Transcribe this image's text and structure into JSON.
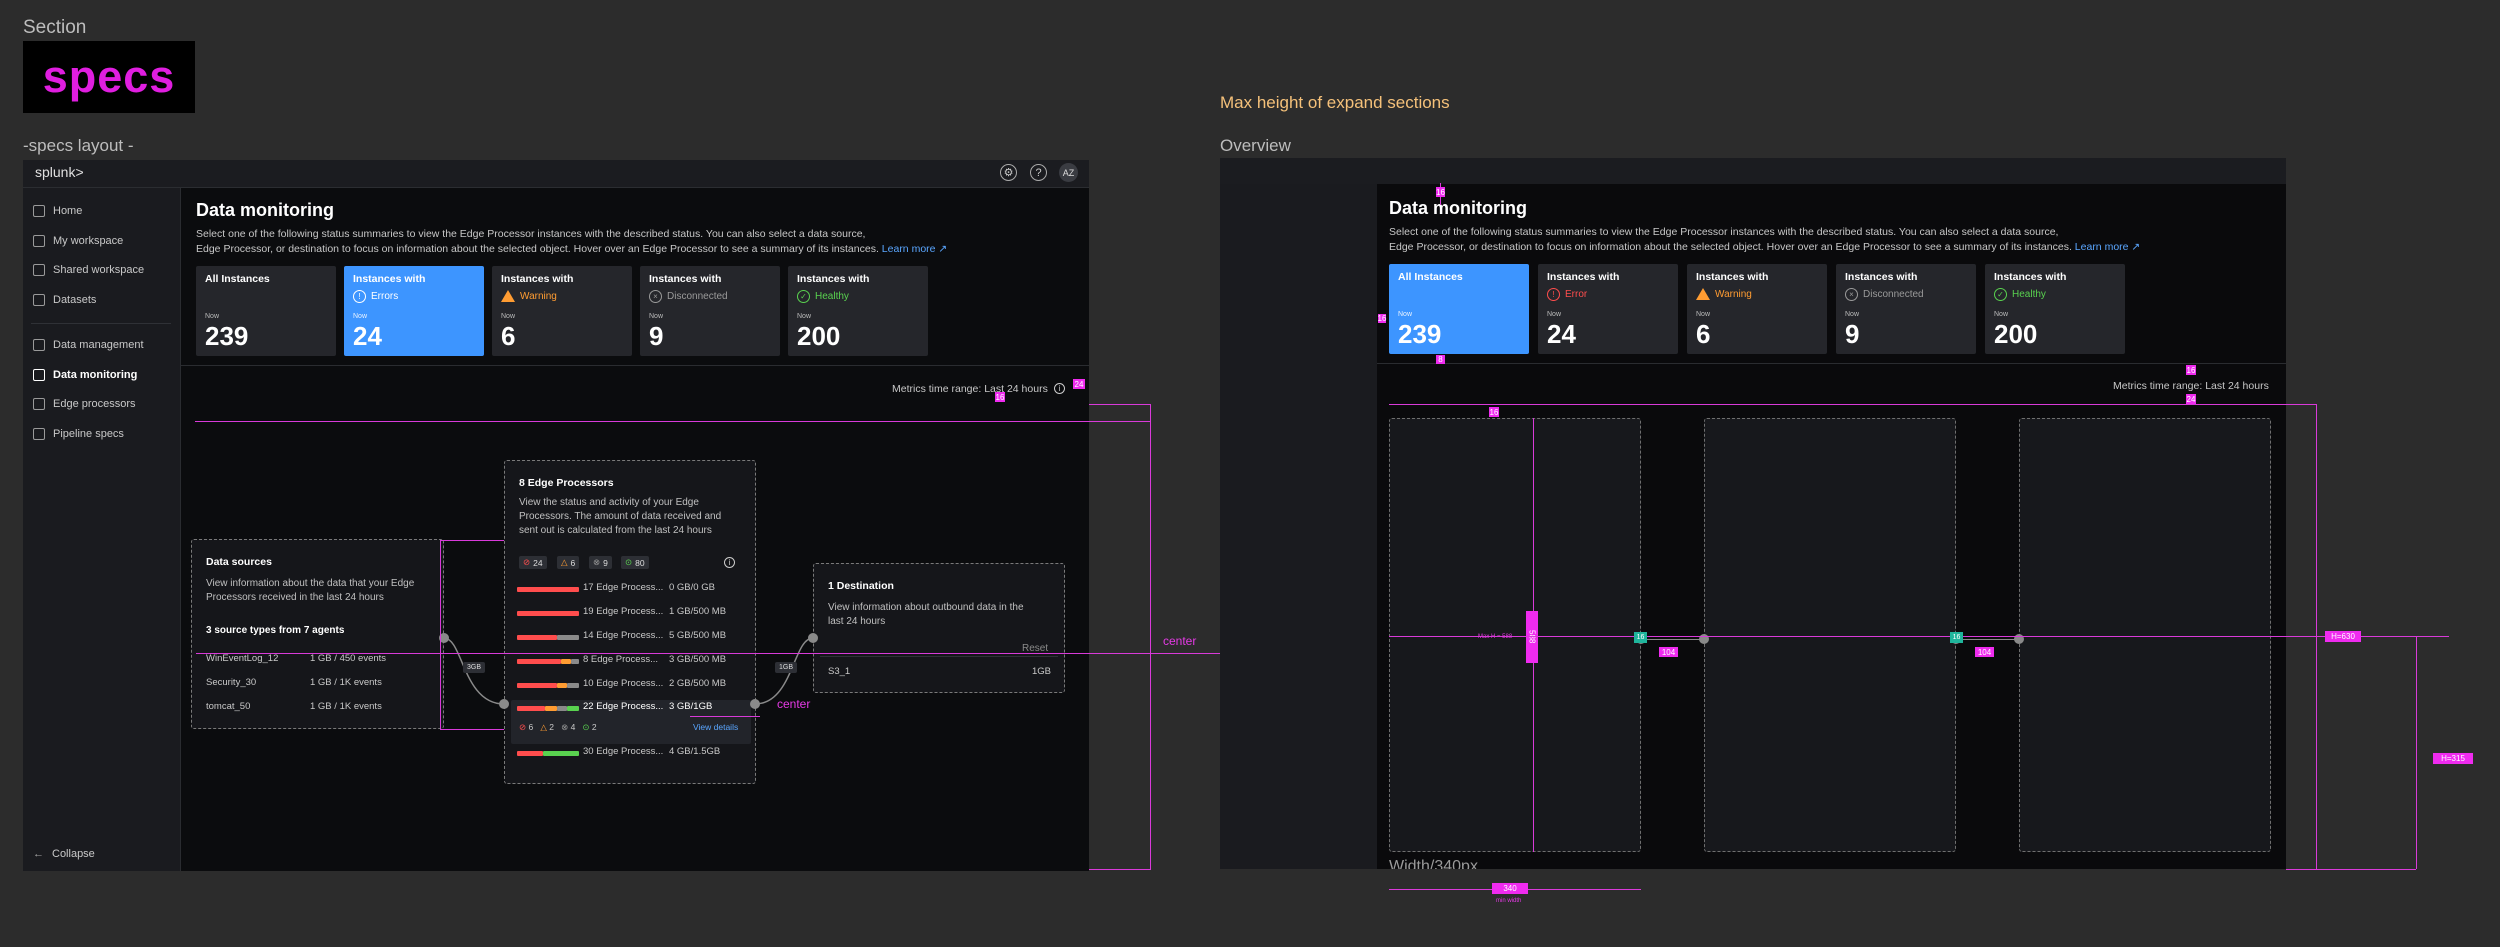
{
  "section_label": "Section",
  "specs_logo": "specs",
  "left_frame": {
    "label": "-specs layout -",
    "app": {
      "logo": "splunk>",
      "icons": [
        "gear-icon",
        "help-icon"
      ],
      "avatar": "AZ",
      "sidebar": {
        "items": [
          {
            "label": "Home",
            "icon": "home-icon"
          },
          {
            "label": "My workspace",
            "icon": "workspace-icon"
          },
          {
            "label": "Shared workspace",
            "icon": "shared-icon"
          },
          {
            "label": "Datasets",
            "icon": "dataset-icon"
          },
          {
            "label": "Data management",
            "icon": "data-icon"
          },
          {
            "label": "Data monitoring",
            "icon": "monitor-icon"
          },
          {
            "label": "Edge processors",
            "icon": "edge-icon"
          },
          {
            "label": "Pipeline specs",
            "icon": "pipeline-icon"
          }
        ],
        "collapse": "Collapse"
      },
      "title": "Data monitoring",
      "description_1": "Select one of the following status summaries to view the Edge Processor instances with the described status.  You can also select a data source,",
      "description_2": "Edge Processor, or destination to focus on information about the selected object. Hover over an Edge Processor to see a summary of its instances.",
      "learn_more": "Learn more",
      "cards": [
        {
          "title": "All Instances",
          "status": "",
          "now": "Now",
          "value": "239"
        },
        {
          "title": "Instances with",
          "status": "Errors",
          "now": "Now",
          "value": "24"
        },
        {
          "title": "Instances with",
          "status": "Warning",
          "now": "Now",
          "value": "6"
        },
        {
          "title": "Instances with",
          "status": "Disconnected",
          "now": "Now",
          "value": "9"
        },
        {
          "title": "Instances with",
          "status": "Healthy",
          "now": "Now",
          "value": "200"
        }
      ],
      "metrics": "Metrics time range: Last 24 hours",
      "sources": {
        "title": "Data sources",
        "text_1": "View information about the data that your Edge",
        "text_2": "Processors received in the last 24 hours",
        "subtitle": "3 source types from 7 agents",
        "rows": [
          {
            "name": "WinEventLog_12",
            "value": "1 GB / 450 events"
          },
          {
            "name": "Security_30",
            "value": "1 GB / 1K events"
          },
          {
            "name": "tomcat_50",
            "value": "1 GB / 1K events"
          }
        ]
      },
      "processors": {
        "title": "8 Edge Processors",
        "text_1": "View the status and activity of your Edge",
        "text_2": "Processors. The amount of data received and",
        "text_3": "sent out is calculated from the last 24 hours",
        "badges": [
          "24",
          "6",
          "9",
          "80"
        ],
        "rows": [
          {
            "name": "17 Edge Process...",
            "value": "0 GB/0 GB"
          },
          {
            "name": "19 Edge Process...",
            "value": "1 GB/500 MB"
          },
          {
            "name": "14 Edge Process...",
            "value": "5 GB/500 MB"
          },
          {
            "name": "8 Edge Process...",
            "value": "3 GB/500 MB"
          },
          {
            "name": "10 Edge Process...",
            "value": "2 GB/500 MB"
          },
          {
            "name": "22 Edge Process...",
            "value": "3 GB/1GB"
          },
          {
            "name": "30 Edge Process...",
            "value": "4 GB/1.5GB"
          }
        ],
        "hover_badges": [
          "6",
          "2",
          "4",
          "2"
        ],
        "view_details": "View details"
      },
      "destination": {
        "title": "1 Destination",
        "text_1": "View information about outbound data in the",
        "text_2": "last 24 hours",
        "reset": "Reset",
        "row": {
          "name": "S3_1",
          "value": "1GB"
        }
      },
      "edge_labels": [
        "3GB",
        "1GB"
      ]
    },
    "annotations": {
      "sp16_a": "16",
      "sp24": "24",
      "center_1": "center",
      "center_2": "center"
    }
  },
  "right_frame": {
    "heading": "Max height of expand sections",
    "label": "Overview",
    "title": "Data monitoring",
    "description_1": "Select one of the following status summaries to view the Edge Processor instances with the described status.  You can also select a data source,",
    "description_2": "Edge Processor, or destination to focus on information about the selected object. Hover over an Edge Processor to see a summary of its instances.",
    "learn_more": "Learn more",
    "cards": [
      {
        "title": "All Instances",
        "status": "",
        "now": "Now",
        "value": "239"
      },
      {
        "title": "Instances with",
        "status": "Error",
        "now": "Now",
        "value": "24"
      },
      {
        "title": "Instances with",
        "status": "Warning",
        "now": "Now",
        "value": "6"
      },
      {
        "title": "Instances with",
        "status": "Disconnected",
        "now": "Now",
        "value": "9"
      },
      {
        "title": "Instances with",
        "status": "Healthy",
        "now": "Now",
        "value": "200"
      }
    ],
    "metrics": "Metrics time range: Last 24 hours",
    "width_caption": "Width/340px",
    "annotations": {
      "sp16": "16",
      "sp8": "8",
      "sp24": "24",
      "maxh_label": "Max H = 588",
      "maxh_tag": "588",
      "gap_104_a": "104",
      "gap_104_b": "104",
      "gap_16": "16",
      "h630": "H=630",
      "h315": "H=315",
      "w340": "340",
      "min_width": "min width"
    }
  },
  "colors": {
    "accent": "#3d95ff",
    "error": "#ff4d4d",
    "warning": "#ff9c32",
    "healthy": "#59d24f",
    "disconnected": "#9a9a9a",
    "annotation": "#ef2bef",
    "teal_tag": "#1fb59c",
    "heading_orange": "#f5c17a"
  }
}
